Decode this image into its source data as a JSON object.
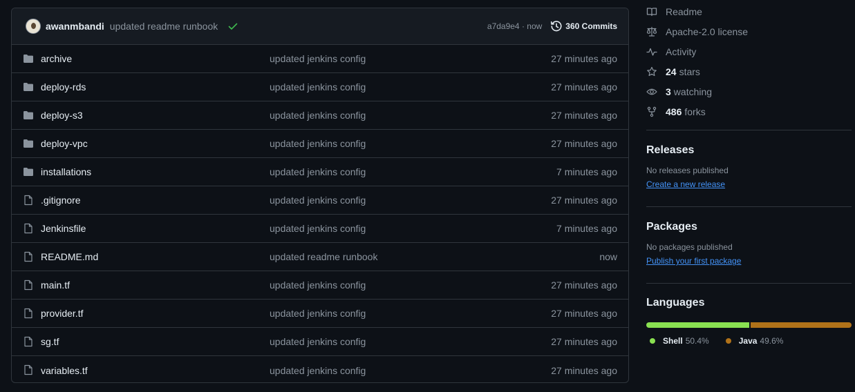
{
  "commit": {
    "author": "awanmbandi",
    "message": "updated readme runbook",
    "sha": "a7da9e4",
    "sha_separator": " · ",
    "time": "now",
    "commits_label": "360 Commits"
  },
  "files": [
    {
      "name": "archive",
      "type": "folder",
      "message": "updated jenkins config",
      "time": "27 minutes ago"
    },
    {
      "name": "deploy-rds",
      "type": "folder",
      "message": "updated jenkins config",
      "time": "27 minutes ago"
    },
    {
      "name": "deploy-s3",
      "type": "folder",
      "message": "updated jenkins config",
      "time": "27 minutes ago"
    },
    {
      "name": "deploy-vpc",
      "type": "folder",
      "message": "updated jenkins config",
      "time": "27 minutes ago"
    },
    {
      "name": "installations",
      "type": "folder",
      "message": "updated jenkins config",
      "time": "7 minutes ago"
    },
    {
      "name": ".gitignore",
      "type": "file",
      "message": "updated jenkins config",
      "time": "27 minutes ago"
    },
    {
      "name": "Jenkinsfile",
      "type": "file",
      "message": "updated jenkins config",
      "time": "7 minutes ago"
    },
    {
      "name": "README.md",
      "type": "file",
      "message": "updated readme runbook",
      "time": "now"
    },
    {
      "name": "main.tf",
      "type": "file",
      "message": "updated jenkins config",
      "time": "27 minutes ago"
    },
    {
      "name": "provider.tf",
      "type": "file",
      "message": "updated jenkins config",
      "time": "27 minutes ago"
    },
    {
      "name": "sg.tf",
      "type": "file",
      "message": "updated jenkins config",
      "time": "27 minutes ago"
    },
    {
      "name": "variables.tf",
      "type": "file",
      "message": "updated jenkins config",
      "time": "27 minutes ago"
    }
  ],
  "about": {
    "readme": "Readme",
    "license": "Apache-2.0 license",
    "activity": "Activity",
    "stars_count": "24",
    "stars_label": "stars",
    "watching_count": "3",
    "watching_label": "watching",
    "forks_count": "486",
    "forks_label": "forks"
  },
  "releases": {
    "title": "Releases",
    "empty": "No releases published",
    "link": "Create a new release"
  },
  "packages": {
    "title": "Packages",
    "empty": "No packages published",
    "link": "Publish your first package"
  },
  "languages": {
    "title": "Languages",
    "items": [
      {
        "name": "Shell",
        "percent": "50.4%",
        "value": 50.4,
        "color": "#89e051"
      },
      {
        "name": "Java",
        "percent": "49.6%",
        "value": 49.6,
        "color": "#b07219"
      }
    ]
  },
  "colors": {
    "background": "#0d1117",
    "border": "#30363d",
    "muted": "#8b949e",
    "link": "#4493f8",
    "success": "#3fb950"
  },
  "icons": {
    "folder": "folder-icon",
    "file": "file-icon",
    "check": "check-icon",
    "history": "history-icon",
    "book": "book-icon",
    "law": "law-icon",
    "pulse": "pulse-icon",
    "star": "star-icon",
    "eye": "eye-icon",
    "fork": "repo-forked-icon"
  }
}
